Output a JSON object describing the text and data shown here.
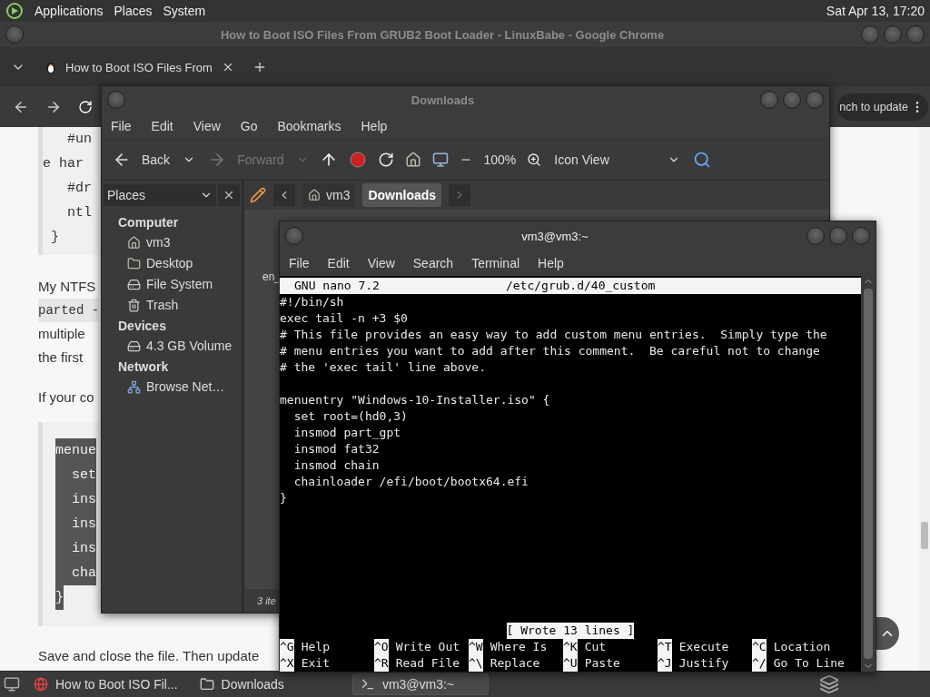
{
  "top_panel": {
    "menus": [
      "Applications",
      "Places",
      "System"
    ],
    "clock": "Sat Apr 13, 17:20"
  },
  "browser": {
    "title": "How to Boot ISO Files From GRUB2 Boot Loader - LinuxBabe - Google Chrome",
    "tab": {
      "title": "How to Boot ISO Files From"
    },
    "update_button": "nch to update",
    "article": {
      "code_block_1": [
        "   #un",
        "e har",
        "   #dr",
        "   ntl",
        " }"
      ],
      "paragraph_lines": [
        {
          "kind": "text",
          "text": "My NTFS"
        },
        {
          "kind": "code",
          "text": "parted -"
        },
        {
          "kind": "text",
          "text": "multiple"
        },
        {
          "kind": "text",
          "text": "the first"
        }
      ],
      "paragraph_2": "If your co",
      "code_block_2": [
        "menue",
        "  set",
        "  ins",
        "  ins",
        "  ins",
        "  cha",
        "}"
      ],
      "paragraph_3": "Save and close the file. Then update"
    }
  },
  "file_manager": {
    "title": "Downloads",
    "menus": [
      "File",
      "Edit",
      "View",
      "Go",
      "Bookmarks",
      "Help"
    ],
    "toolbar": {
      "back": {
        "label": "Back",
        "disabled": false
      },
      "forward": {
        "label": "Forward",
        "disabled": true
      },
      "zoom": "100%",
      "view": "Icon View"
    },
    "sidebar": {
      "header": "Places",
      "sections": [
        {
          "title": "Computer",
          "items": [
            {
              "label": "vm3",
              "kind": "home"
            },
            {
              "label": "Desktop",
              "kind": "desktop"
            },
            {
              "label": "File System",
              "kind": "drive"
            },
            {
              "label": "Trash",
              "kind": "trash"
            }
          ]
        },
        {
          "title": "Devices",
          "items": [
            {
              "label": "4.3 GB Volume",
              "kind": "drive"
            }
          ]
        },
        {
          "title": "Network",
          "items": [
            {
              "label": "Browse Net…",
              "kind": "network"
            }
          ]
        }
      ]
    },
    "path": [
      {
        "label": "vm3",
        "selected": false
      },
      {
        "label": "Downloads",
        "selected": true
      }
    ],
    "file_label": "en_",
    "status": "3 ite"
  },
  "terminal": {
    "title": "vm3@vm3:~",
    "menus": [
      "File",
      "Edit",
      "View",
      "Search",
      "Terminal",
      "Help"
    ],
    "nano": {
      "version": "GNU nano 7.2",
      "file": "/etc/grub.d/40_custom",
      "header_lines": [
        "#!/bin/sh",
        "exec tail -n +3 $0",
        "# This file provides an easy way to add custom menu entries.  Simply type the",
        "# menu entries you want to add after this comment.  Be careful not to change",
        "# the 'exec tail' line above."
      ],
      "entry_lines": [
        "menuentry \"Windows-10-Installer.iso\" {",
        "  set root=(hd0,3)",
        "  insmod part_gpt",
        "  insmod fat32",
        "  insmod chain",
        "  chainloader /efi/boot/bootx64.efi",
        "}"
      ],
      "status": "[ Wrote 13 lines ]",
      "shortcuts": [
        [
          {
            "key": "^G",
            "label": "Help"
          },
          {
            "key": "^O",
            "label": "Write Out"
          },
          {
            "key": "^W",
            "label": "Where Is"
          },
          {
            "key": "^K",
            "label": "Cut"
          },
          {
            "key": "^T",
            "label": "Execute"
          },
          {
            "key": "^C",
            "label": "Location"
          }
        ],
        [
          {
            "key": "^X",
            "label": "Exit"
          },
          {
            "key": "^R",
            "label": "Read File"
          },
          {
            "key": "^\\",
            "label": "Replace"
          },
          {
            "key": "^U",
            "label": "Paste"
          },
          {
            "key": "^J",
            "label": "Justify"
          },
          {
            "key": "^/",
            "label": "Go To Line"
          }
        ]
      ]
    }
  },
  "taskbar": {
    "items": [
      {
        "kind": "chrome",
        "label": "How to Boot ISO Fil...",
        "selected": false
      },
      {
        "kind": "folder",
        "label": "Downloads",
        "selected": false
      },
      {
        "kind": "terminal",
        "label": "vm3@vm3:~",
        "selected": true
      }
    ]
  }
}
